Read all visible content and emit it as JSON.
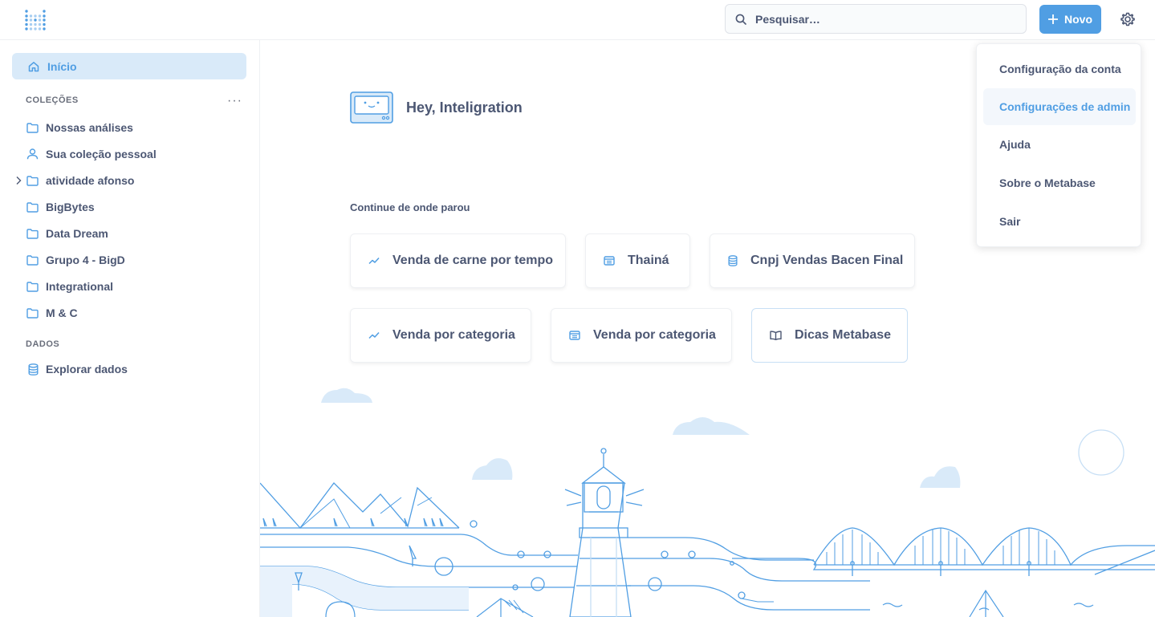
{
  "colors": {
    "brand": "#509ee3",
    "text": "#4c5773",
    "muted": "#696e7b",
    "selected_bg": "#d9eaf9"
  },
  "header": {
    "logo_icon": "metabase-logo-icon",
    "search_placeholder": "Pesquisar…",
    "new_button_label": "Novo",
    "settings_icon": "gear-icon"
  },
  "sidebar": {
    "home_label": "Início",
    "collections_label": "COLEÇÕES",
    "more_label": "···",
    "collections": [
      {
        "label": "Nossas análises",
        "icon": "folder-icon"
      },
      {
        "label": "Sua coleção pessoal",
        "icon": "person-icon"
      },
      {
        "label": "atividade afonso",
        "icon": "folder-icon",
        "expandable": true
      },
      {
        "label": "BigBytes",
        "icon": "folder-icon"
      },
      {
        "label": "Data Dream",
        "icon": "folder-icon"
      },
      {
        "label": "Grupo 4 - BigD",
        "icon": "folder-icon"
      },
      {
        "label": "Integrational",
        "icon": "folder-icon"
      },
      {
        "label": "M & C",
        "icon": "folder-icon"
      }
    ],
    "data_label": "DADOS",
    "explore_label": "Explorar dados"
  },
  "main": {
    "greeting": "Hey, Inteligration",
    "continue_label": "Continue de onde parou",
    "cards": [
      {
        "label": "Venda de carne por tempo",
        "icon": "line-chart-icon"
      },
      {
        "label": "Thainá",
        "icon": "table-icon"
      },
      {
        "label": "Cnpj Vendas Bacen Final",
        "icon": "database-icon"
      },
      {
        "label": "Venda por categoria",
        "icon": "line-chart-icon"
      },
      {
        "label": "Venda por categoria",
        "icon": "table-icon"
      },
      {
        "label": "Dicas Metabase",
        "icon": "book-icon"
      }
    ]
  },
  "settings_menu": {
    "items": [
      {
        "label": "Configuração da conta"
      },
      {
        "label": "Configurações de admin",
        "active": true
      },
      {
        "label": "Ajuda"
      },
      {
        "label": "Sobre o Metabase"
      },
      {
        "label": "Sair"
      }
    ]
  }
}
